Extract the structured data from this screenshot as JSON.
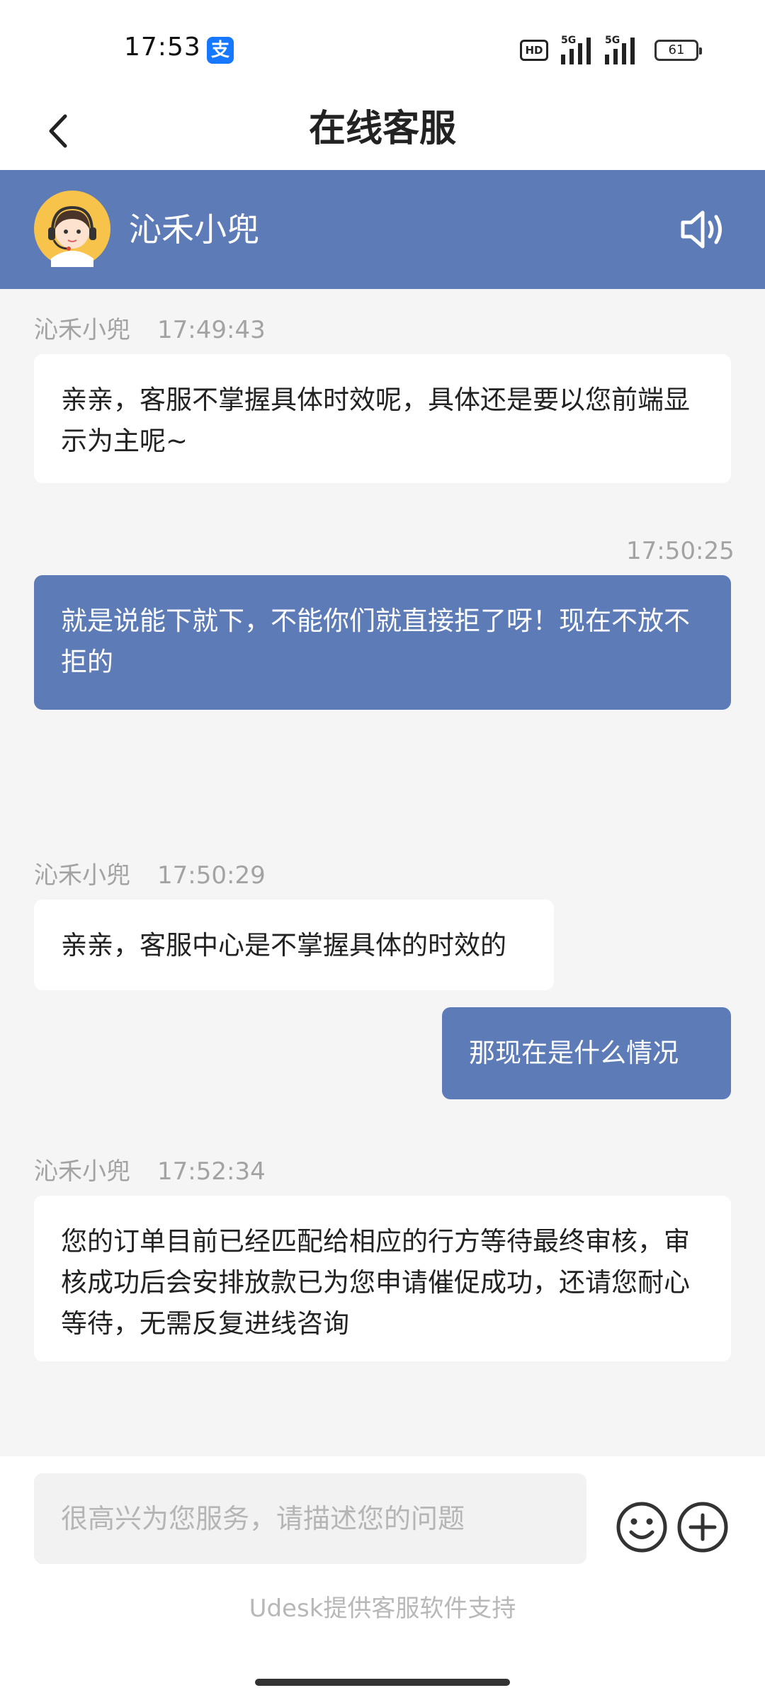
{
  "status_bar": {
    "time": "17:53",
    "app_badge_icon": "alipay-icon",
    "app_badge_glyph": "支",
    "hd_label": "HD",
    "signal_1_label": "5G",
    "signal_2_label": "5G",
    "battery_level": "61"
  },
  "header": {
    "back_icon": "chevron-left-icon",
    "title": "在线客服"
  },
  "agent": {
    "name": "沁禾小兜",
    "avatar_icon": "support-agent-avatar",
    "sound_icon": "speaker-icon"
  },
  "messages": [
    {
      "direction": "in",
      "sender": "沁禾小兜",
      "time": "17:49:43",
      "text": "亲亲，客服不掌握具体时效呢，具体还是要以您前端显示为主呢~"
    },
    {
      "direction": "out",
      "sender": "",
      "time": "17:50:25",
      "text": "就是说能下就下，不能你们就直接拒了呀！现在不放不拒的"
    },
    {
      "direction": "in",
      "sender": "沁禾小兜",
      "time": "17:50:29",
      "text": "亲亲，客服中心是不掌握具体的时效的"
    },
    {
      "direction": "out",
      "sender": "",
      "time": "",
      "text": "那现在是什么情况"
    },
    {
      "direction": "in",
      "sender": "沁禾小兜",
      "time": "17:52:34",
      "text": "您的订单目前已经匹配给相应的行方等待最终审核，审核成功后会安排放款已为您申请催促成功，还请您耐心等待，无需反复进线咨询"
    }
  ],
  "input": {
    "placeholder": "很高兴为您服务，请描述您的问题",
    "emoji_icon": "smiley-icon",
    "more_icon": "plus-circle-icon"
  },
  "footer": {
    "powered_by": "Udesk提供客服软件支持"
  },
  "colors": {
    "accent": "#5d7bb6",
    "background": "#f5f5f5",
    "bubble_in": "#ffffff",
    "meta_text": "#a3a3a3"
  }
}
